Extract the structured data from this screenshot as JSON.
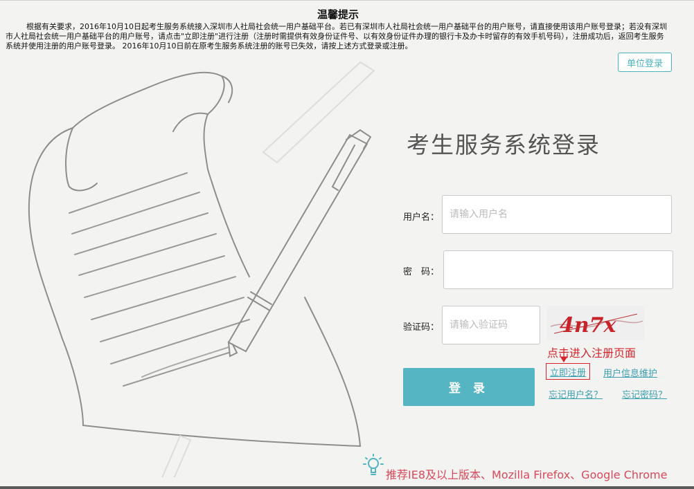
{
  "notice": {
    "title": "温馨提示",
    "text": "根据有关要求，2016年10月10日起考生服务系统接入深圳市人社局社会统一用户基础平台。若已有深圳市人社局社会统一用户基础平台的用户账号，请直接使用该用户账号登录；若没有深圳市人社局社会统一用户基础平台的用户账号，请点击\"立即注册\"进行注册（注册时需提供有效身份证件号、以有效身份证件办理的银行卡及办卡时留存的有效手机号码），注册成功后，返回考生服务系统并使用注册的用户账号登录。 2016年10月10日前在原考生服务系统注册的账号已失效，请按上述方式登录或注册。"
  },
  "header": {
    "unit_login": "单位登录"
  },
  "login": {
    "title": "考生服务系统登录",
    "username_label": "用户名：",
    "username_placeholder": "请输入用户名",
    "password_label": "密　码：",
    "captcha_label": "验证码：",
    "captcha_placeholder": "请输入验证码",
    "captcha_text": "4n7x",
    "hint": "点击进入注册页面",
    "register": "立即注册",
    "user_info": "用户信息维护",
    "forgot_username": "忘记用户名？",
    "forgot_password": "忘记密码？",
    "submit": "登 录"
  },
  "footer": {
    "browser_tip": "推荐IE8及以上版本、Mozilla Firefox、Google Chrome"
  },
  "colors": {
    "accent": "#56b5c3",
    "link": "#3a9fb0",
    "alert": "#d9232a"
  }
}
